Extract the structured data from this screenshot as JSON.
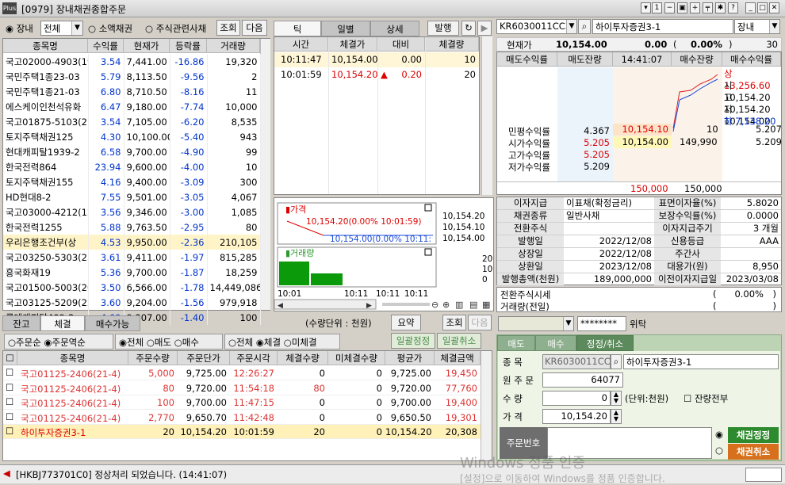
{
  "window": {
    "code": "[0979]",
    "title": "장내채권종합주문",
    "logo": "Plus"
  },
  "left": {
    "market_opts": [
      "장내",
      "소액채권",
      "주식관련사채"
    ],
    "filter_value": "전체",
    "search_btn": "조회",
    "next_btn": "다음",
    "headers": [
      "종목명",
      "수익률",
      "현재가",
      "등락률",
      "거래량"
    ],
    "rows": [
      [
        "국고02000-4903(19",
        "3.54",
        "7,441.00",
        "-16.86",
        "19,320"
      ],
      [
        "국민주택1종23-03",
        "5.79",
        "8,113.50",
        "-9.56",
        "2"
      ],
      [
        "국민주택1종21-03",
        "6.80",
        "8,710.50",
        "-8.16",
        "11"
      ],
      [
        "에스케이인천석유화",
        "6.47",
        "9,180.00",
        "-7.74",
        "10,000"
      ],
      [
        "국고01875-5103(21",
        "3.54",
        "7,105.00",
        "-6.20",
        "8,535"
      ],
      [
        "토지주택채권125",
        "4.30",
        "10,100.00",
        "-5.40",
        "943"
      ],
      [
        "현대캐피탈1939-2",
        "6.58",
        "9,700.00",
        "-4.90",
        "99"
      ],
      [
        "한국전력864",
        "23.94",
        "9,600.00",
        "-4.00",
        "10"
      ],
      [
        "토지주택채권155",
        "4.16",
        "9,400.00",
        "-3.09",
        "300"
      ],
      [
        "HD현대8-2",
        "7.55",
        "9,501.00",
        "-3.05",
        "4,067"
      ],
      [
        "국고03000-4212(12",
        "3.56",
        "9,346.00",
        "-3.00",
        "1,085"
      ],
      [
        "한국전력1255",
        "5.88",
        "9,763.50",
        "-2.95",
        "80"
      ],
      [
        "우리은행조건부(상",
        "4.53",
        "9,950.00",
        "-2.36",
        "210,105"
      ],
      [
        "국고03250-5303(23",
        "3.61",
        "9,411.00",
        "-1.97",
        "815,285"
      ],
      [
        "흥국화재19",
        "5.36",
        "9,700.00",
        "-1.87",
        "18,259"
      ],
      [
        "국고01500-5003(20",
        "3.50",
        "6,566.00",
        "-1.78",
        "14,449,086"
      ],
      [
        "국고03125-5209(22",
        "3.60",
        "9,204.00",
        "-1.56",
        "979,918"
      ],
      [
        "롯데캐피탈409-3",
        "4.69",
        "9,307.00",
        "-1.40",
        "100"
      ]
    ]
  },
  "tick": {
    "tabs": [
      "틱",
      "일별",
      "상세"
    ],
    "issue_btn": "발행",
    "headers": [
      "시간",
      "체결가",
      "대비",
      "체결량"
    ],
    "rows": [
      {
        "time": "10:11:47",
        "price": "10,154.00",
        "diff": "0.00",
        "arrow": "",
        "qty": "10"
      },
      {
        "time": "10:01:59",
        "price": "10,154.20",
        "diff": "0.20",
        "arrow": "▲",
        "qty": "20"
      }
    ]
  },
  "chart_data": {
    "type": "line",
    "series": [
      {
        "name": "가격",
        "x": [
          "10:01:59",
          "10:11:47"
        ],
        "values": [
          10154.2,
          10154.0
        ]
      },
      {
        "name": "거래량",
        "x": [
          "10:01",
          "10:11"
        ],
        "values": [
          20,
          10
        ]
      }
    ],
    "annotations": [
      "10,154.20(0.00% 10:01:59)",
      "10,154.00(0.00% 10:11:"
    ],
    "y_ticks": [
      "10,154.20",
      "10,154.10",
      "10,154.00"
    ],
    "vol_ticks": [
      "20",
      "10",
      "0"
    ],
    "x_ticks": [
      "10:01",
      "10:11",
      "10:11",
      "10:11"
    ]
  },
  "quote": {
    "code": "KR6030011CC3",
    "name": "하이투자증권3-1",
    "market": "장내",
    "qty_unit": "30",
    "current_label": "현재가",
    "current_price": "10,154.00",
    "change": "0.00",
    "change_pct": "0.00%",
    "headers": [
      "매도수익률",
      "매도잔량",
      "14:41:07",
      "매수잔량",
      "매수수익률"
    ],
    "bid": {
      "price1": "10,154.10",
      "qty1": "10",
      "yield1": "5.207",
      "price2": "10,154.00",
      "qty2": "149,990",
      "yield2": "5.209"
    },
    "stats": [
      [
        "민평수익률",
        "4.367"
      ],
      [
        "시가수익률",
        "5.205"
      ],
      [
        "고가수익률",
        "5.205"
      ],
      [
        "저가수익률",
        "5.209"
      ]
    ],
    "ohlc": [
      [
        "상",
        "13,256.60"
      ],
      [
        "시",
        "10,154.20"
      ],
      [
        "고",
        "10,154.20"
      ],
      [
        "저",
        "10,154.00"
      ],
      [
        "하",
        "7,138.20"
      ]
    ],
    "totals": {
      "sell": "150,000",
      "buy": "150,000"
    }
  },
  "info": {
    "rows": [
      [
        "이자지급",
        "이표채(확정금리)",
        "표면이자율(%)",
        "5.8020"
      ],
      [
        "채권종류",
        "일반사채",
        "보장수익률(%)",
        "0.0000"
      ],
      [
        "전환주식",
        "",
        "이자지급주기",
        "3 개월"
      ],
      [
        "발행일",
        "2022/12/08",
        "신용등급",
        "AAA"
      ],
      [
        "상장일",
        "2022/12/08",
        "주간사",
        ""
      ],
      [
        "상환일",
        "2023/12/08",
        "대용가(원)",
        "8,950"
      ],
      [
        "발행총액(천원)",
        "189,000,000",
        "이전이자지급일",
        "2023/03/08"
      ]
    ],
    "conv_label": "전환주식시세",
    "conv_val": "0.00%",
    "vol_label": "거래량(전일)"
  },
  "orders": {
    "tabs": [
      "잔고",
      "체결",
      "매수가능"
    ],
    "unit": "(수량단위 : 천원)",
    "summary_btn": "요약",
    "query_btn": "조회",
    "next_btn": "다음",
    "opts1": [
      "주문순",
      "주문역순"
    ],
    "opts2": [
      "전체",
      "매도",
      "매수"
    ],
    "opts3": [
      "전체",
      "체결",
      "미체결"
    ],
    "bulk_modify": "일괄정정",
    "bulk_cancel": "일괄취소",
    "headers": [
      "종목명",
      "주문수량",
      "주문단가",
      "주문시각",
      "체결수량",
      "미체결수량",
      "평균가",
      "체결금액"
    ],
    "rows": [
      [
        "국고01125-2406(21-4)",
        "5,000",
        "9,725.00",
        "12:26:27",
        "0",
        "0",
        "9,725.00",
        "19,450"
      ],
      [
        "국고01125-2406(21-4)",
        "80",
        "9,720.00",
        "11:54:18",
        "80",
        "0",
        "9,720.00",
        "77,760"
      ],
      [
        "국고01125-2406(21-4)",
        "100",
        "9,700.00",
        "11:47:15",
        "0",
        "0",
        "9,700.00",
        "19,400"
      ],
      [
        "국고01125-2406(21-4)",
        "2,770",
        "9,650.70",
        "11:42:48",
        "0",
        "0",
        "9,650.50",
        "19,301"
      ],
      [
        "하이투자증권3-1",
        "20",
        "10,154.20",
        "10:01:59",
        "20",
        "0",
        "10,154.20",
        "20,308"
      ]
    ]
  },
  "form": {
    "password": "********",
    "proxy_label": "위탁",
    "tabs": [
      "매도",
      "매수",
      "정정/취소"
    ],
    "code_label": "종    목",
    "code": "KR6030011CC3",
    "name": "하이투자증권3-1",
    "orig_label": "원 주 문",
    "orig": "64077",
    "qty_label": "수      량",
    "qty": "0",
    "unit": "(단위:천원)",
    "all_label": "잔량전부",
    "price_label": "가      격",
    "price": "10,154.20",
    "orderno_label": "주문번호",
    "modify_btn": "채권정정",
    "cancel_btn": "채권취소"
  },
  "status": {
    "message": "[HKBJ773701C0] 정상처리 되었습니다. (14:41:07)"
  },
  "watermark": {
    "line1": "Windows 정품 인증",
    "line2": "[설정]으로 이동하여 Windows를 정품 인증합니다."
  }
}
